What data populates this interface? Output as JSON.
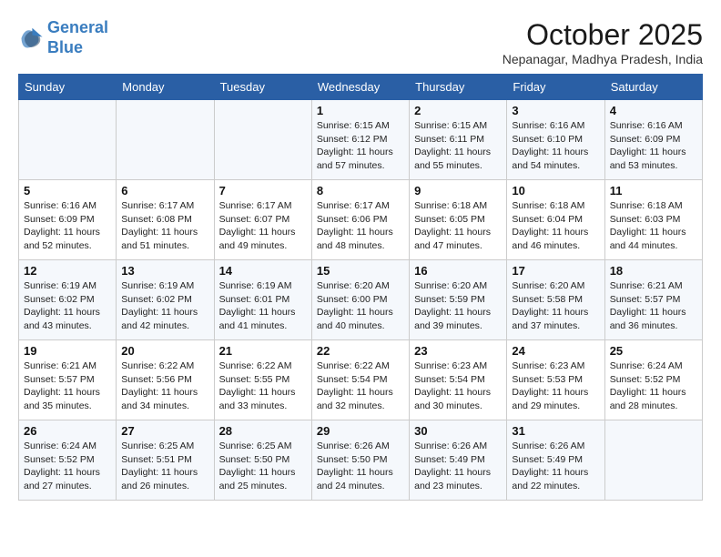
{
  "header": {
    "logo_line1": "General",
    "logo_line2": "Blue",
    "month": "October 2025",
    "location": "Nepanagar, Madhya Pradesh, India"
  },
  "days_of_week": [
    "Sunday",
    "Monday",
    "Tuesday",
    "Wednesday",
    "Thursday",
    "Friday",
    "Saturday"
  ],
  "weeks": [
    [
      {
        "day": "",
        "detail": ""
      },
      {
        "day": "",
        "detail": ""
      },
      {
        "day": "",
        "detail": ""
      },
      {
        "day": "1",
        "detail": "Sunrise: 6:15 AM\nSunset: 6:12 PM\nDaylight: 11 hours\nand 57 minutes."
      },
      {
        "day": "2",
        "detail": "Sunrise: 6:15 AM\nSunset: 6:11 PM\nDaylight: 11 hours\nand 55 minutes."
      },
      {
        "day": "3",
        "detail": "Sunrise: 6:16 AM\nSunset: 6:10 PM\nDaylight: 11 hours\nand 54 minutes."
      },
      {
        "day": "4",
        "detail": "Sunrise: 6:16 AM\nSunset: 6:09 PM\nDaylight: 11 hours\nand 53 minutes."
      }
    ],
    [
      {
        "day": "5",
        "detail": "Sunrise: 6:16 AM\nSunset: 6:09 PM\nDaylight: 11 hours\nand 52 minutes."
      },
      {
        "day": "6",
        "detail": "Sunrise: 6:17 AM\nSunset: 6:08 PM\nDaylight: 11 hours\nand 51 minutes."
      },
      {
        "day": "7",
        "detail": "Sunrise: 6:17 AM\nSunset: 6:07 PM\nDaylight: 11 hours\nand 49 minutes."
      },
      {
        "day": "8",
        "detail": "Sunrise: 6:17 AM\nSunset: 6:06 PM\nDaylight: 11 hours\nand 48 minutes."
      },
      {
        "day": "9",
        "detail": "Sunrise: 6:18 AM\nSunset: 6:05 PM\nDaylight: 11 hours\nand 47 minutes."
      },
      {
        "day": "10",
        "detail": "Sunrise: 6:18 AM\nSunset: 6:04 PM\nDaylight: 11 hours\nand 46 minutes."
      },
      {
        "day": "11",
        "detail": "Sunrise: 6:18 AM\nSunset: 6:03 PM\nDaylight: 11 hours\nand 44 minutes."
      }
    ],
    [
      {
        "day": "12",
        "detail": "Sunrise: 6:19 AM\nSunset: 6:02 PM\nDaylight: 11 hours\nand 43 minutes."
      },
      {
        "day": "13",
        "detail": "Sunrise: 6:19 AM\nSunset: 6:02 PM\nDaylight: 11 hours\nand 42 minutes."
      },
      {
        "day": "14",
        "detail": "Sunrise: 6:19 AM\nSunset: 6:01 PM\nDaylight: 11 hours\nand 41 minutes."
      },
      {
        "day": "15",
        "detail": "Sunrise: 6:20 AM\nSunset: 6:00 PM\nDaylight: 11 hours\nand 40 minutes."
      },
      {
        "day": "16",
        "detail": "Sunrise: 6:20 AM\nSunset: 5:59 PM\nDaylight: 11 hours\nand 39 minutes."
      },
      {
        "day": "17",
        "detail": "Sunrise: 6:20 AM\nSunset: 5:58 PM\nDaylight: 11 hours\nand 37 minutes."
      },
      {
        "day": "18",
        "detail": "Sunrise: 6:21 AM\nSunset: 5:57 PM\nDaylight: 11 hours\nand 36 minutes."
      }
    ],
    [
      {
        "day": "19",
        "detail": "Sunrise: 6:21 AM\nSunset: 5:57 PM\nDaylight: 11 hours\nand 35 minutes."
      },
      {
        "day": "20",
        "detail": "Sunrise: 6:22 AM\nSunset: 5:56 PM\nDaylight: 11 hours\nand 34 minutes."
      },
      {
        "day": "21",
        "detail": "Sunrise: 6:22 AM\nSunset: 5:55 PM\nDaylight: 11 hours\nand 33 minutes."
      },
      {
        "day": "22",
        "detail": "Sunrise: 6:22 AM\nSunset: 5:54 PM\nDaylight: 11 hours\nand 32 minutes."
      },
      {
        "day": "23",
        "detail": "Sunrise: 6:23 AM\nSunset: 5:54 PM\nDaylight: 11 hours\nand 30 minutes."
      },
      {
        "day": "24",
        "detail": "Sunrise: 6:23 AM\nSunset: 5:53 PM\nDaylight: 11 hours\nand 29 minutes."
      },
      {
        "day": "25",
        "detail": "Sunrise: 6:24 AM\nSunset: 5:52 PM\nDaylight: 11 hours\nand 28 minutes."
      }
    ],
    [
      {
        "day": "26",
        "detail": "Sunrise: 6:24 AM\nSunset: 5:52 PM\nDaylight: 11 hours\nand 27 minutes."
      },
      {
        "day": "27",
        "detail": "Sunrise: 6:25 AM\nSunset: 5:51 PM\nDaylight: 11 hours\nand 26 minutes."
      },
      {
        "day": "28",
        "detail": "Sunrise: 6:25 AM\nSunset: 5:50 PM\nDaylight: 11 hours\nand 25 minutes."
      },
      {
        "day": "29",
        "detail": "Sunrise: 6:26 AM\nSunset: 5:50 PM\nDaylight: 11 hours\nand 24 minutes."
      },
      {
        "day": "30",
        "detail": "Sunrise: 6:26 AM\nSunset: 5:49 PM\nDaylight: 11 hours\nand 23 minutes."
      },
      {
        "day": "31",
        "detail": "Sunrise: 6:26 AM\nSunset: 5:49 PM\nDaylight: 11 hours\nand 22 minutes."
      },
      {
        "day": "",
        "detail": ""
      }
    ]
  ]
}
